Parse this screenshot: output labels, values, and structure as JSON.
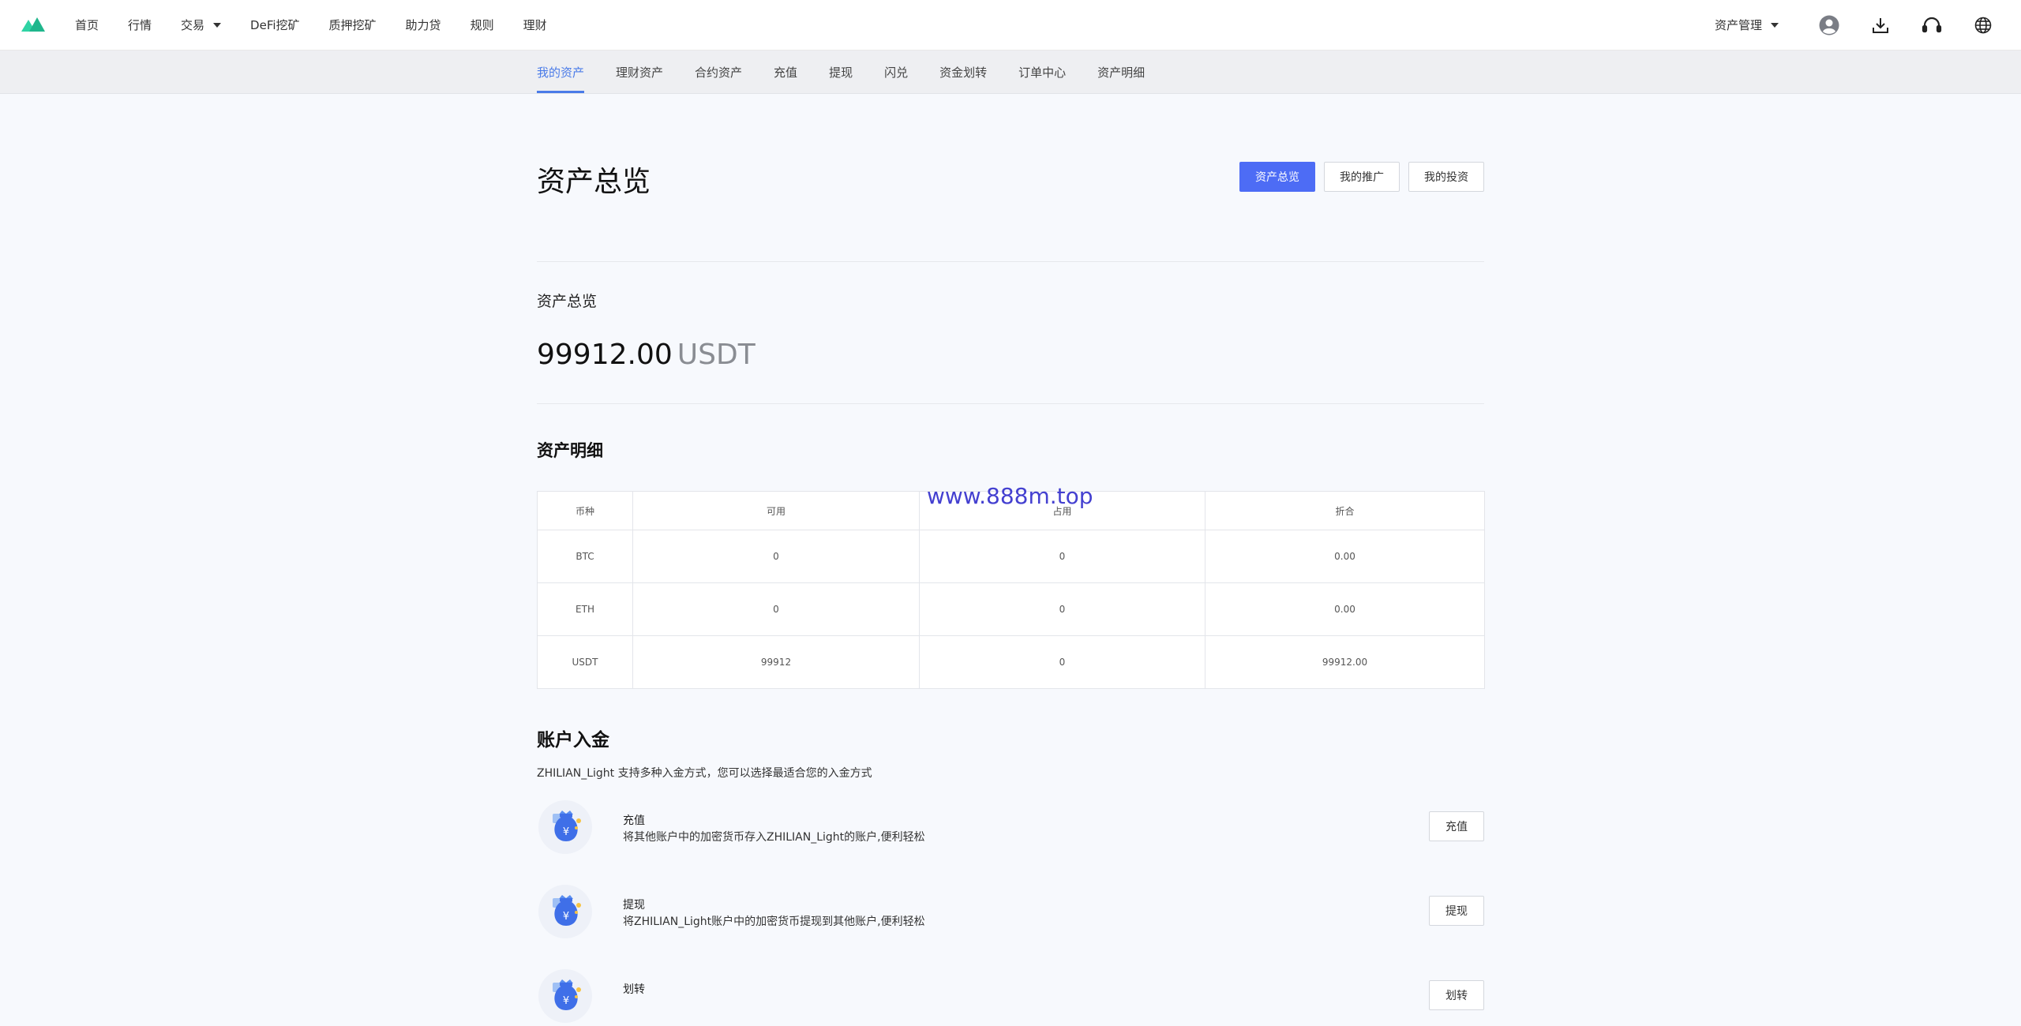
{
  "nav": {
    "items": [
      "首页",
      "行情",
      "交易",
      "DeFi挖矿",
      "质押挖矿",
      "助力贷",
      "规则",
      "理财"
    ],
    "asset_menu": "资产管理"
  },
  "subnav": {
    "items": [
      "我的资产",
      "理财资产",
      "合约资产",
      "充值",
      "提现",
      "闪兑",
      "资金划转",
      "订单中心",
      "资产明细"
    ],
    "active": "我的资产"
  },
  "page": {
    "title": "资产总览",
    "buttons": [
      "资产总览",
      "我的推广",
      "我的投资"
    ]
  },
  "overview": {
    "label": "资产总览",
    "amount": "99912.00",
    "unit": "USDT"
  },
  "detail": {
    "title": "资产明细",
    "columns": [
      "币种",
      "可用",
      "占用",
      "折合"
    ],
    "rows": [
      [
        "BTC",
        "0",
        "0",
        "0.00"
      ],
      [
        "ETH",
        "0",
        "0",
        "0.00"
      ],
      [
        "USDT",
        "99912",
        "0",
        "99912.00"
      ]
    ]
  },
  "watermark": "www.888m.top",
  "deposit": {
    "title": "账户入金",
    "desc": "ZHILIAN_Light 支持多种入金方式，您可以选择最适合您的入金方式",
    "methods": [
      {
        "name": "充值",
        "text": "将其他账户中的加密货币存入ZHILIAN_Light的账户,便利轻松",
        "button": "充值"
      },
      {
        "name": "提现",
        "text": "将ZHILIAN_Light账户中的加密货币提现到其他账户,便利轻松",
        "button": "提现"
      },
      {
        "name": "划转",
        "text": "",
        "button": "划转"
      }
    ]
  },
  "colors": {
    "accent": "#4a7be8",
    "primary_button": "#4d6cf5",
    "logo": "#2fd3a4",
    "watermark": "#4440d0"
  },
  "icons": [
    "logo-icon",
    "caret-down-icon",
    "user-avatar-icon",
    "download-icon",
    "headset-icon",
    "globe-icon",
    "money-bag-icon"
  ]
}
